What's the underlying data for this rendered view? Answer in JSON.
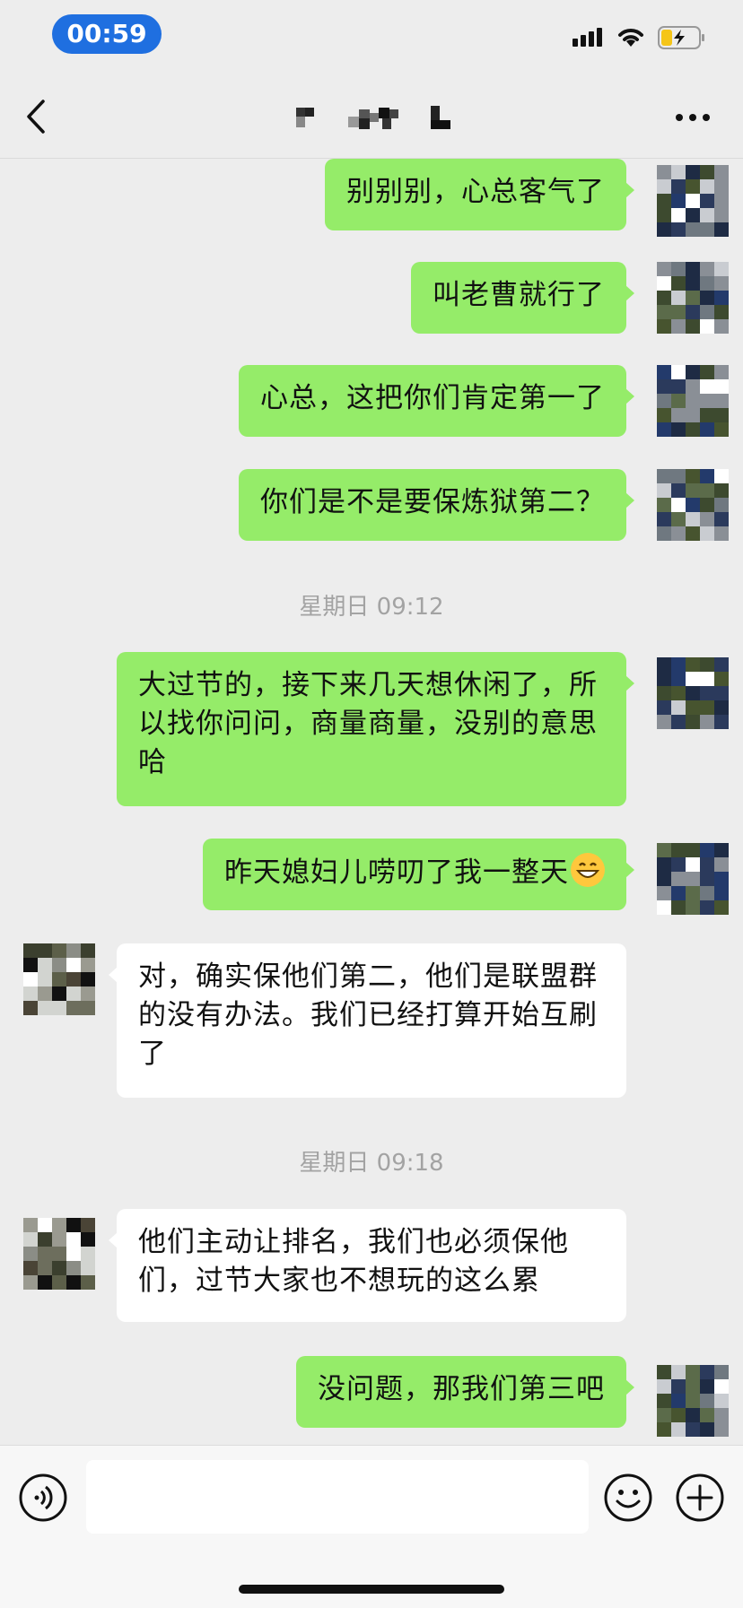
{
  "status_bar": {
    "time": "00:59"
  },
  "header": {
    "title": ""
  },
  "messages": [
    {
      "side": "me",
      "text": "别别别，心总客气了"
    },
    {
      "side": "me",
      "text": "叫老曹就行了"
    },
    {
      "side": "me",
      "text": "心总，这把你们肯定第一了"
    },
    {
      "side": "me",
      "text": "你们是不是要保炼狱第二？"
    },
    {
      "timestamp": "星期日 09:12"
    },
    {
      "side": "me",
      "text": "大过节的，接下来几天想休闲了，所以找你问问，商量商量，没别的意思哈"
    },
    {
      "side": "me",
      "text": "昨天媳妇儿唠叨了我一整天",
      "emoji": "grinning-face"
    },
    {
      "side": "them",
      "text": "对，确实保他们第二，他们是联盟群的没有办法。我们已经打算开始互刷了"
    },
    {
      "timestamp": "星期日 09:18"
    },
    {
      "side": "them",
      "text": "他们主动让排名，我们也必须保他们，过节大家也不想玩的这么累"
    },
    {
      "side": "me",
      "text": "没问题，那我们第三吧"
    }
  ],
  "input": {
    "value": ""
  },
  "colors": {
    "me_bubble": "#95EC69",
    "them_bubble": "#FFFFFF",
    "background": "#EDEDED",
    "time_pill": "#1F6FE0"
  },
  "icons": [
    "back-chevron-icon",
    "more-icon",
    "voice-icon",
    "emoji-icon",
    "plus-icon",
    "signal-icon",
    "wifi-icon",
    "battery-icon"
  ]
}
